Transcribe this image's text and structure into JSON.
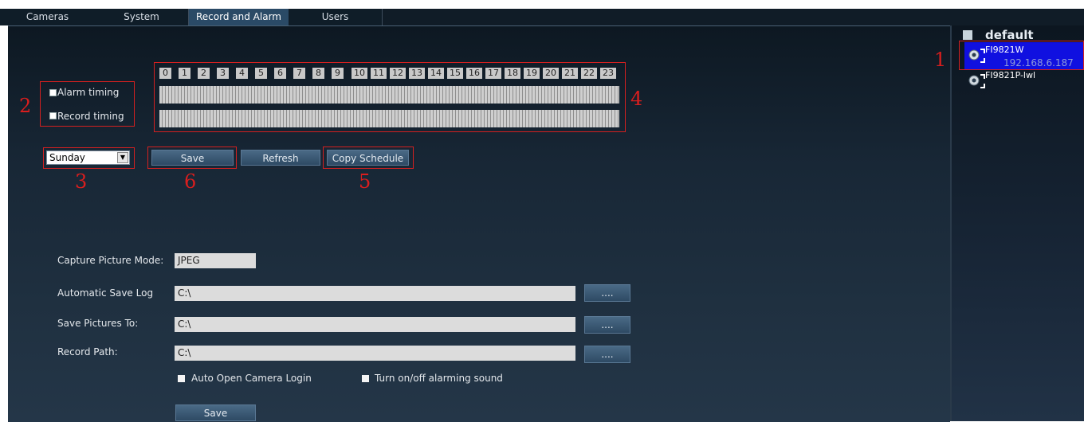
{
  "menu": {
    "tabs": [
      {
        "label": "Cameras"
      },
      {
        "label": "System"
      },
      {
        "label": "Record and Alarm"
      },
      {
        "label": "Users"
      }
    ],
    "active": "Record and Alarm"
  },
  "schedule": {
    "hours": [
      "0",
      "1",
      "2",
      "3",
      "4",
      "5",
      "6",
      "7",
      "8",
      "9",
      "10",
      "11",
      "12",
      "13",
      "14",
      "15",
      "16",
      "17",
      "18",
      "19",
      "20",
      "21",
      "22",
      "23"
    ],
    "alarm_timing_label": "Alarm timing",
    "record_timing_label": "Record timing",
    "day_selected": "Sunday",
    "save_label": "Save",
    "refresh_label": "Refresh",
    "copy_label": "Copy Schedule"
  },
  "annotations": {
    "m1": "1",
    "m2": "2",
    "m3": "3",
    "m4": "4",
    "m5": "5",
    "m6": "6",
    "color": "#d91e1e"
  },
  "settings": {
    "capture_mode_label": "Capture Picture Mode:",
    "capture_mode_value": "JPEG",
    "auto_save_log_label": "Automatic Save Log",
    "auto_save_log_value": "C:\\",
    "save_pictures_label": "Save Pictures To:",
    "save_pictures_value": "C:\\",
    "record_path_label": "Record Path:",
    "record_path_value": "C:\\",
    "browse_label": "....",
    "auto_open_label": "Auto Open Camera Login",
    "alarm_sound_label": "Turn on/off alarming sound",
    "save_label": "Save"
  },
  "device_tree": {
    "group": "default",
    "devices": [
      {
        "name": "FI9821W",
        "ip": "192.168.6.187",
        "selected": true
      },
      {
        "name": "FI9821P-lwl"
      }
    ]
  },
  "colors": {
    "accent": "#2a4a66",
    "selection": "#1010e0",
    "panel": "#1f3040"
  }
}
